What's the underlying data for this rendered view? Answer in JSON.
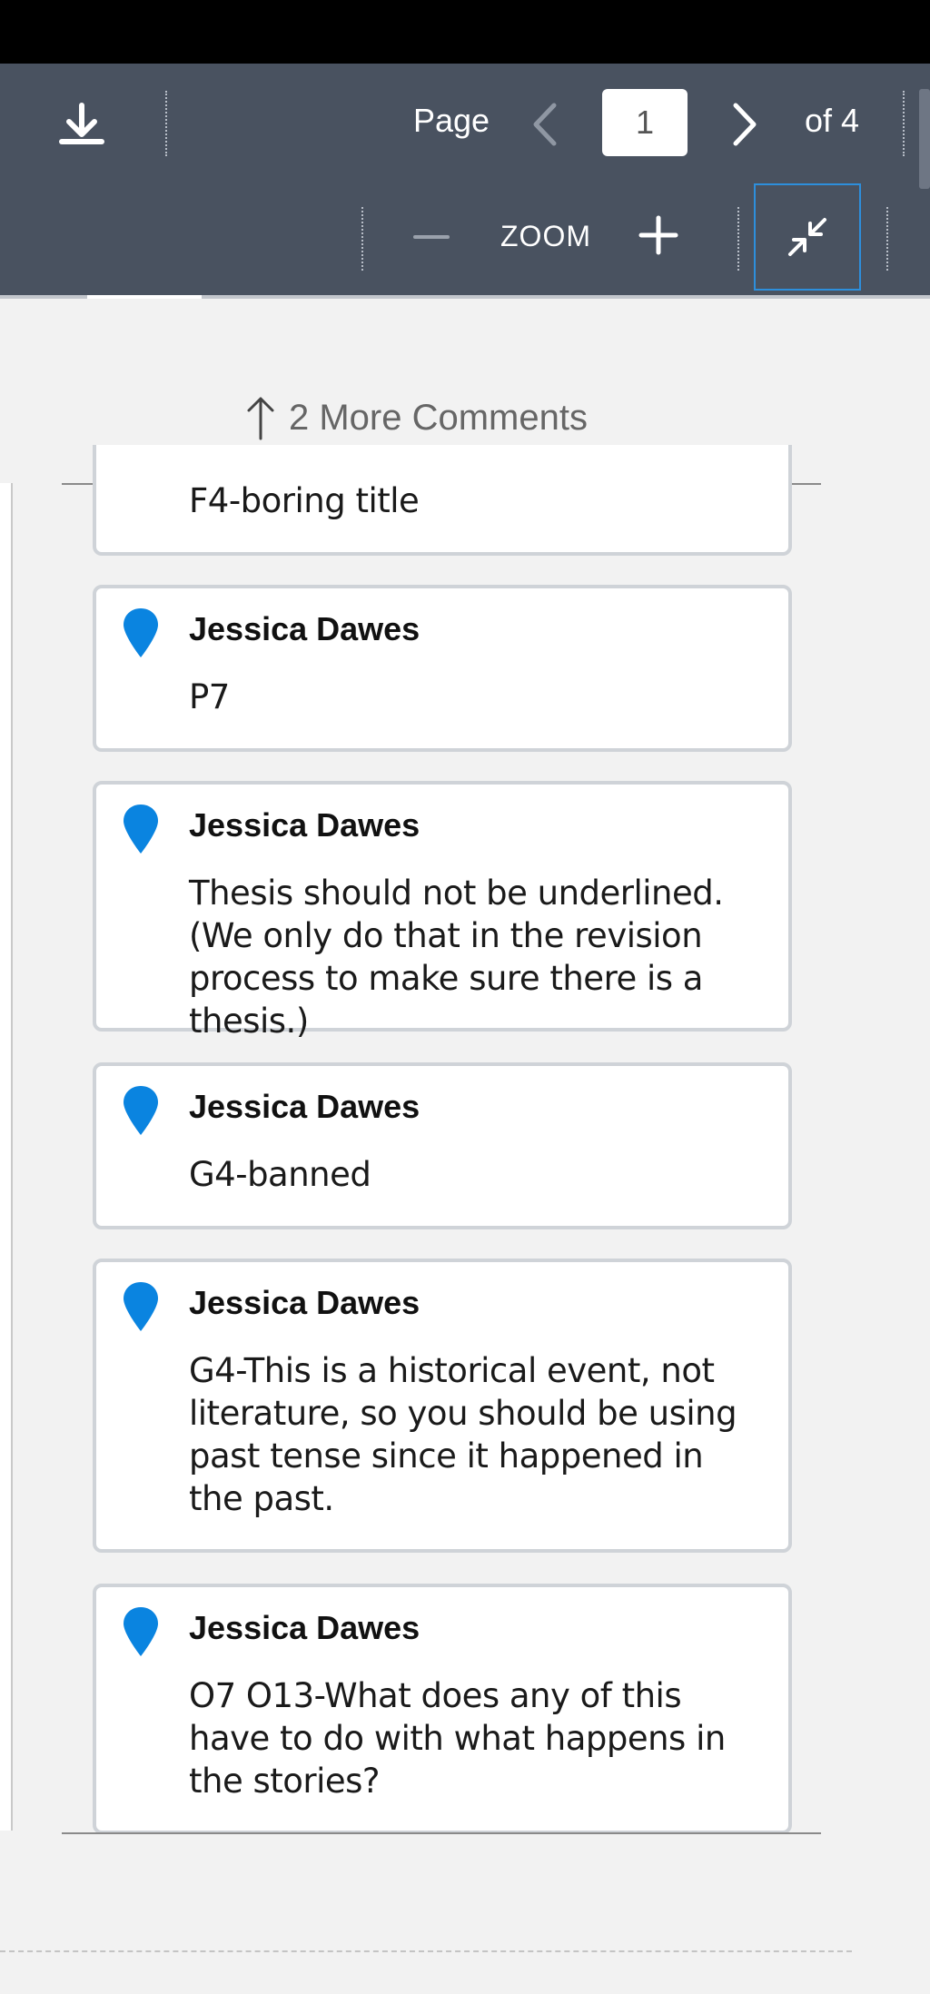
{
  "toolbar": {
    "page_label": "Page",
    "current_page": "1",
    "page_of": "of 4",
    "zoom_label": "ZOOM"
  },
  "more_comments": {
    "label": "2 More Comments"
  },
  "comments": [
    {
      "author": "",
      "text": "F4-boring title"
    },
    {
      "author": "Jessica Dawes",
      "text": "P7"
    },
    {
      "author": "Jessica Dawes",
      "text": "Thesis should not be underlined. (We only do that in the revision process to make sure there is a thesis.)"
    },
    {
      "author": "Jessica Dawes",
      "text": "G4-banned"
    },
    {
      "author": "Jessica Dawes",
      "text": "G4-This is a historical event, not literature, so you should be using past tense since it happened in the past."
    },
    {
      "author": "Jessica Dawes",
      "text": "O7 O13-What does any of this have to do with what happens in the stories?"
    }
  ],
  "colors": {
    "toolbar_bg": "#495260",
    "pin": "#0a84e0",
    "focus_border": "#2d8fdc"
  },
  "icons": [
    "download-icon",
    "chevron-left-icon",
    "chevron-right-icon",
    "minus-icon",
    "plus-icon",
    "collapse-icon",
    "arrow-up-icon",
    "pin-icon"
  ]
}
